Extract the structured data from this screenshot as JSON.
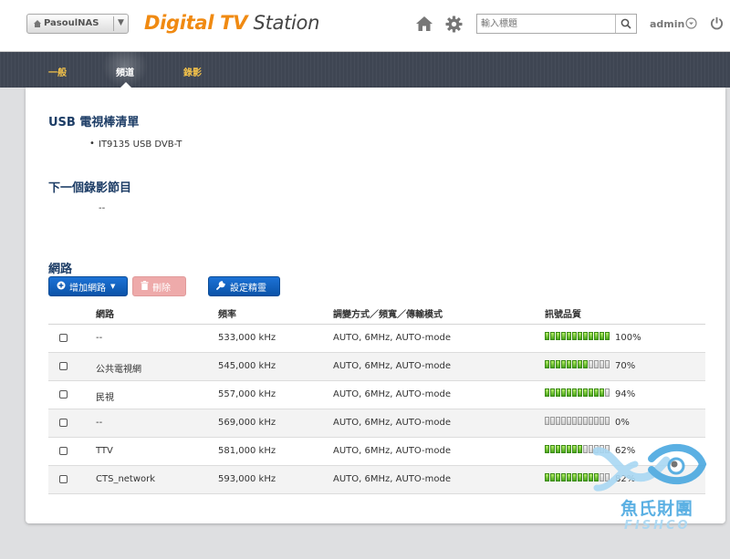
{
  "header": {
    "nas_name": "PasoulNAS",
    "app_title_bold": "Digital TV",
    "app_title_thin": " Station",
    "search_placeholder": "輸入標題",
    "user": "admin"
  },
  "nav": {
    "tabs": [
      {
        "label": "一般",
        "active": false
      },
      {
        "label": "頻道",
        "active": true
      },
      {
        "label": "錄影",
        "active": false
      }
    ]
  },
  "usb_section": {
    "title": "USB 電視棒清單",
    "devices": [
      "IT9135 USB DVB-T"
    ]
  },
  "next_section": {
    "title": "下一個錄影節目",
    "value": "--"
  },
  "network_section": {
    "title": "網路",
    "add_button": "增加網路",
    "delete_button": "刪除",
    "settings_button": "設定精靈"
  },
  "table": {
    "headers": [
      "網路",
      "頻率",
      "調變方式／頻寬／傳輸模式",
      "訊號品質"
    ],
    "rows": [
      {
        "network": "--",
        "freq": "533,000 kHz",
        "mode": "AUTO, 6MHz, AUTO-mode",
        "signal": 100,
        "signal_text": "100%"
      },
      {
        "network": "公共電視網",
        "freq": "545,000 kHz",
        "mode": "AUTO, 6MHz, AUTO-mode",
        "signal": 70,
        "signal_text": "70%"
      },
      {
        "network": "民視",
        "freq": "557,000 kHz",
        "mode": "AUTO, 6MHz, AUTO-mode",
        "signal": 94,
        "signal_text": "94%"
      },
      {
        "network": "--",
        "freq": "569,000 kHz",
        "mode": "AUTO, 6MHz, AUTO-mode",
        "signal": 0,
        "signal_text": "0%"
      },
      {
        "network": "TTV",
        "freq": "581,000 kHz",
        "mode": "AUTO, 6MHz, AUTO-mode",
        "signal": 62,
        "signal_text": "62%"
      },
      {
        "network": "CTS_network",
        "freq": "593,000 kHz",
        "mode": "AUTO, 6MHz, AUTO-mode",
        "signal": 82,
        "signal_text": "82%"
      }
    ]
  },
  "watermark": {
    "text": "魚氏財團",
    "sub": "FISHCO"
  },
  "colors": {
    "accent": "#f08a12",
    "nav_bg": "#3f4653",
    "button_blue": "#0b53a8",
    "signal_green": "#4aa61a",
    "section_title": "#1d3d66"
  }
}
